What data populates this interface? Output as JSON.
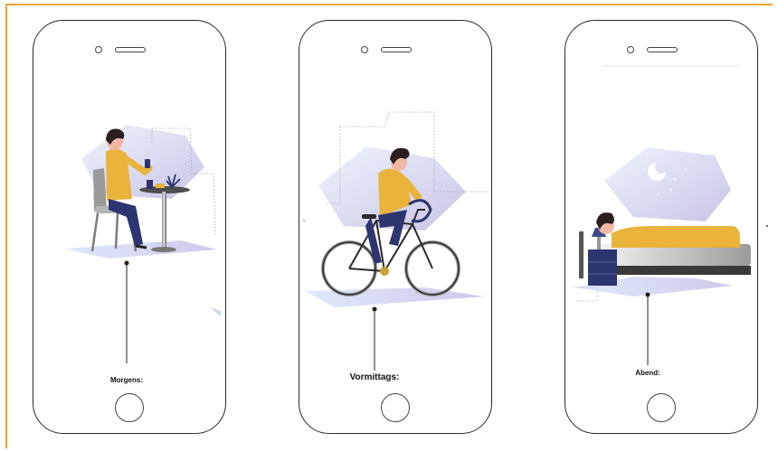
{
  "panels": [
    {
      "label": "Morgens:"
    },
    {
      "label": "Vormittags:"
    },
    {
      "label": "Abend:"
    }
  ],
  "icons": {
    "scene1": "person-at-cafe-table-with-phone",
    "scene2": "person-riding-bicycle",
    "scene3": "person-sleeping-in-bed-moon-night"
  },
  "colors": {
    "border": "#f2a531",
    "shirt": "#e9b33c",
    "pants": "#2c3570",
    "hair": "#2a1f1e",
    "skin": "#f2b8a5",
    "gradient_start": "#e4eefb",
    "gradient_end": "#c8c4e6"
  }
}
